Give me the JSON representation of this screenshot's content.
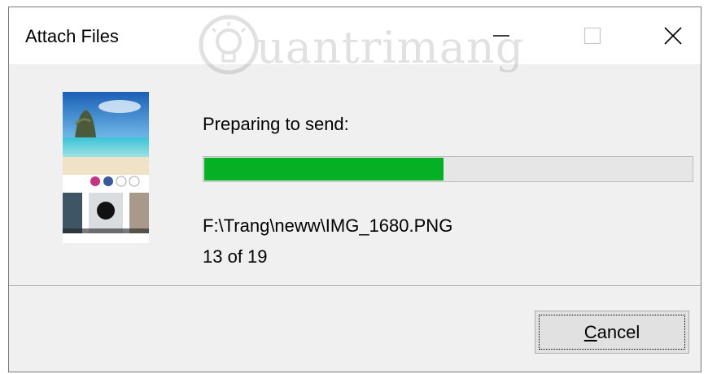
{
  "window": {
    "title": "Attach Files",
    "controls": [
      "minimize",
      "maximize",
      "close"
    ]
  },
  "watermark": {
    "text": "uantrimang",
    "icon": "lightbulb-icon"
  },
  "thumbnail": {
    "icon": "image-preview"
  },
  "status": {
    "label": "Preparing to send:",
    "progress": 0.49,
    "file_path": "F:\\Trang\\neww\\IMG_1680.PNG",
    "count_text": "13 of 19"
  },
  "buttons": {
    "cancel_label": "Cancel"
  },
  "colors": {
    "progress_fill": "#06b025",
    "dialog_bg": "#f0f0f0"
  }
}
